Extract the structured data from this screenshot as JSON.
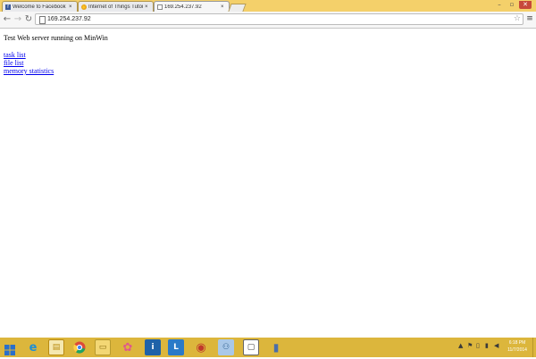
{
  "browser": {
    "tabs": [
      {
        "label": "Welcome to Facebook - L",
        "favicon": "facebook-icon",
        "active": false
      },
      {
        "label": "Internet of Things Tutoria",
        "favicon": "instructables-icon",
        "active": false
      },
      {
        "label": "169.254.237.92",
        "favicon": "page-icon",
        "active": true
      }
    ],
    "tab_close_glyph": "×",
    "window_controls": {
      "minimize": "–",
      "restore": "▫",
      "close": "✕"
    },
    "nav": {
      "back": "←",
      "forward": "→",
      "reload": "↻"
    },
    "address": "169.254.237.92",
    "star_glyph": "☆",
    "menu_glyph": "≡"
  },
  "page": {
    "heading": "Test Web server running on MinWin",
    "links": [
      "task list",
      "file list",
      "memory statistics"
    ]
  },
  "taskbar": {
    "time": "6:18 PM",
    "date": "11/7/2014",
    "pinned": [
      {
        "name": "ie-icon",
        "glyph": "e",
        "color": "#1e8fd5"
      },
      {
        "name": "calendar-icon",
        "glyph": "▤",
        "color": "#b98b12"
      },
      {
        "name": "chrome-icon",
        "glyph": "●",
        "color": "#dd4b39"
      },
      {
        "name": "file-explorer-icon",
        "glyph": "▭",
        "color": "#e8c24a"
      },
      {
        "name": "photos-icon",
        "glyph": "✿",
        "color": "#e05a8a"
      },
      {
        "name": "intel-icon",
        "glyph": "i",
        "color": "#1e62a8"
      },
      {
        "name": "lync-icon",
        "glyph": "L",
        "color": "#2a7ac8"
      },
      {
        "name": "media-icon",
        "glyph": "◉",
        "color": "#c0392b"
      },
      {
        "name": "network-icon",
        "glyph": "⚇",
        "color": "#3f7fbf"
      },
      {
        "name": "window-icon",
        "glyph": "▢",
        "color": "#5a5a5a"
      },
      {
        "name": "device-icon",
        "glyph": "▮",
        "color": "#4b6ea8"
      }
    ]
  }
}
